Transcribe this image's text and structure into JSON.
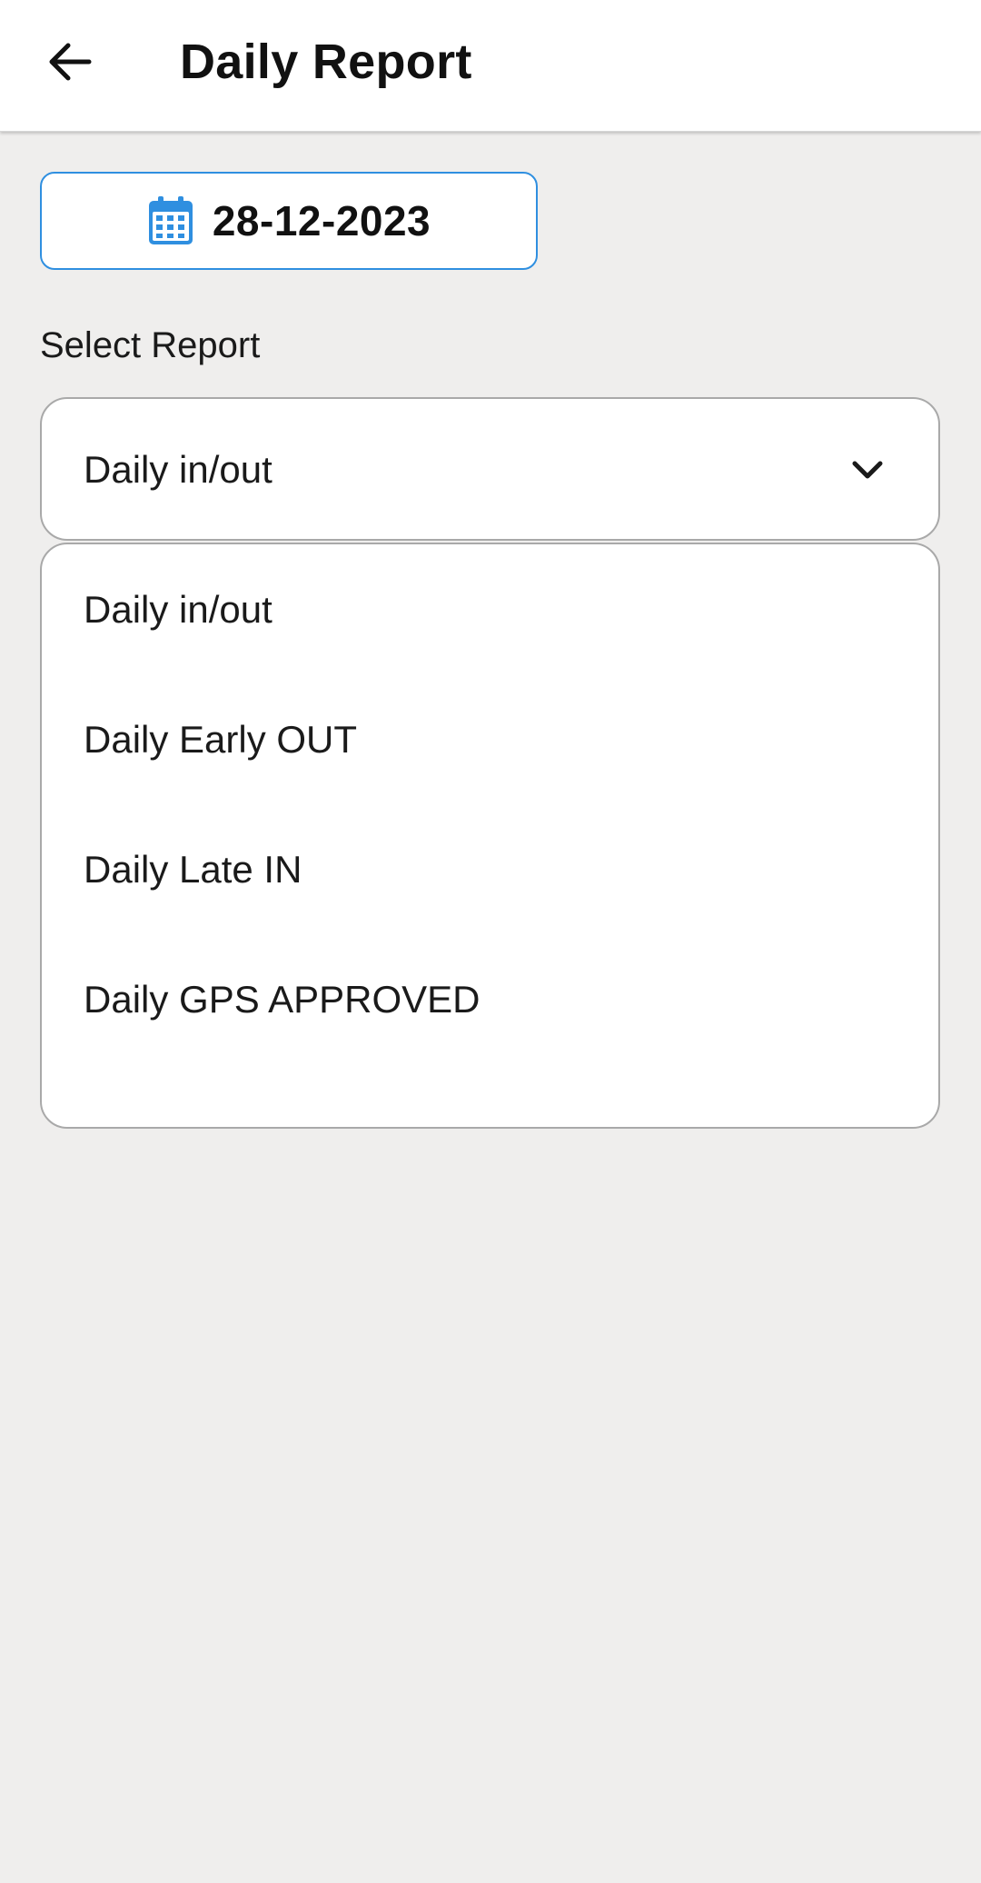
{
  "header": {
    "title": "Daily Report",
    "back_icon": "arrow-left-icon"
  },
  "date_picker": {
    "icon": "calendar-icon",
    "value": "28-12-2023",
    "accent_color": "#2f8fe0"
  },
  "report_select": {
    "label": "Select Report",
    "selected": "Daily in/out",
    "icon": "chevron-down-icon",
    "options": [
      "Daily in/out",
      "Daily Early OUT",
      "Daily Late IN",
      "Daily GPS APPROVED"
    ]
  }
}
